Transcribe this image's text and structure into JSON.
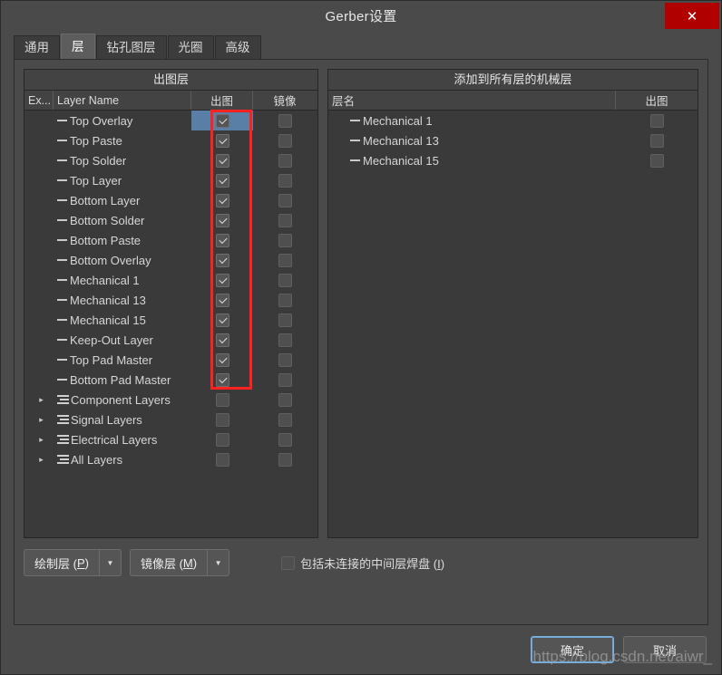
{
  "window": {
    "title": "Gerber设置",
    "close_label": "✕"
  },
  "tabs": [
    {
      "label": "通用",
      "active": false
    },
    {
      "label": "层",
      "active": true
    },
    {
      "label": "钻孔图层",
      "active": false
    },
    {
      "label": "光圈",
      "active": false
    },
    {
      "label": "高级",
      "active": false
    }
  ],
  "left_panel": {
    "title": "出图层",
    "columns": [
      "Ex...",
      "Layer Name",
      "出图",
      "镜像"
    ],
    "rows": [
      {
        "name": "Top Overlay",
        "type": "leaf",
        "plot": true,
        "mirror": false,
        "selected": true
      },
      {
        "name": "Top Paste",
        "type": "leaf",
        "plot": true,
        "mirror": false,
        "selected": false
      },
      {
        "name": "Top Solder",
        "type": "leaf",
        "plot": true,
        "mirror": false,
        "selected": false
      },
      {
        "name": "Top Layer",
        "type": "leaf",
        "plot": true,
        "mirror": false,
        "selected": false
      },
      {
        "name": "Bottom Layer",
        "type": "leaf",
        "plot": true,
        "mirror": false,
        "selected": false
      },
      {
        "name": "Bottom Solder",
        "type": "leaf",
        "plot": true,
        "mirror": false,
        "selected": false
      },
      {
        "name": "Bottom Paste",
        "type": "leaf",
        "plot": true,
        "mirror": false,
        "selected": false
      },
      {
        "name": "Bottom Overlay",
        "type": "leaf",
        "plot": true,
        "mirror": false,
        "selected": false
      },
      {
        "name": "Mechanical 1",
        "type": "leaf",
        "plot": true,
        "mirror": false,
        "selected": false
      },
      {
        "name": "Mechanical 13",
        "type": "leaf",
        "plot": true,
        "mirror": false,
        "selected": false
      },
      {
        "name": "Mechanical 15",
        "type": "leaf",
        "plot": true,
        "mirror": false,
        "selected": false
      },
      {
        "name": "Keep-Out Layer",
        "type": "leaf",
        "plot": true,
        "mirror": false,
        "selected": false
      },
      {
        "name": "Top Pad Master",
        "type": "leaf",
        "plot": true,
        "mirror": false,
        "selected": false
      },
      {
        "name": "Bottom Pad Master",
        "type": "leaf",
        "plot": true,
        "mirror": false,
        "selected": false
      },
      {
        "name": "Component Layers",
        "type": "group",
        "plot": false,
        "mirror": false,
        "selected": false
      },
      {
        "name": "Signal Layers",
        "type": "group",
        "plot": false,
        "mirror": false,
        "selected": false
      },
      {
        "name": "Electrical Layers",
        "type": "group",
        "plot": false,
        "mirror": false,
        "selected": false
      },
      {
        "name": "All Layers",
        "type": "group",
        "plot": false,
        "mirror": false,
        "selected": false
      }
    ]
  },
  "right_panel": {
    "title": "添加到所有层的机械层",
    "columns": [
      "层名",
      "出图"
    ],
    "rows": [
      {
        "name": "Mechanical 1",
        "plot": false
      },
      {
        "name": "Mechanical 13",
        "plot": false
      },
      {
        "name": "Mechanical 15",
        "plot": false
      }
    ]
  },
  "controls": {
    "plot_layers": {
      "label_main": "绘制层 (",
      "accel": "P",
      "label_tail": ")"
    },
    "mirror_layers": {
      "label_main": "镜像层 (",
      "accel": "M",
      "label_tail": ")"
    },
    "include_pads": {
      "label_main": "包括未连接的中间层焊盘 (",
      "accel": "I",
      "label_tail": ")",
      "checked": false
    }
  },
  "footer": {
    "ok_label": "确定",
    "cancel_label": "取消",
    "watermark": "https://blog.csdn.net/aiwr_"
  },
  "annotation": {
    "color": "#ff2020",
    "note": "red-highlight-plot-column"
  }
}
